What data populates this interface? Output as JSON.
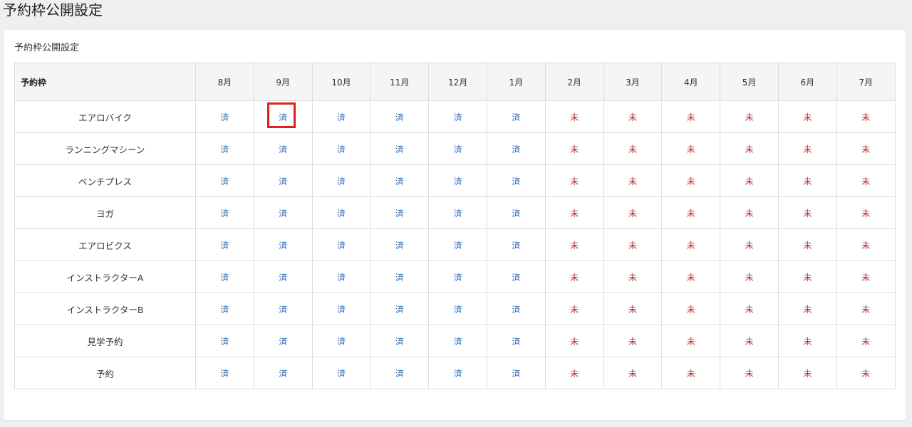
{
  "page": {
    "title": "予約枠公開設定"
  },
  "panel": {
    "title": "予約枠公開設定"
  },
  "table": {
    "corner_header": "予約枠",
    "months": [
      "8月",
      "9月",
      "10月",
      "11月",
      "12月",
      "1月",
      "2月",
      "3月",
      "4月",
      "5月",
      "6月",
      "7月"
    ],
    "rows": [
      {
        "label": "エアロバイク",
        "statuses": [
          "済",
          "済",
          "済",
          "済",
          "済",
          "済",
          "未",
          "未",
          "未",
          "未",
          "未",
          "未"
        ]
      },
      {
        "label": "ランニングマシーン",
        "statuses": [
          "済",
          "済",
          "済",
          "済",
          "済",
          "済",
          "未",
          "未",
          "未",
          "未",
          "未",
          "未"
        ]
      },
      {
        "label": "ベンチプレス",
        "statuses": [
          "済",
          "済",
          "済",
          "済",
          "済",
          "済",
          "未",
          "未",
          "未",
          "未",
          "未",
          "未"
        ]
      },
      {
        "label": "ヨガ",
        "statuses": [
          "済",
          "済",
          "済",
          "済",
          "済",
          "済",
          "未",
          "未",
          "未",
          "未",
          "未",
          "未"
        ]
      },
      {
        "label": "エアロビクス",
        "statuses": [
          "済",
          "済",
          "済",
          "済",
          "済",
          "済",
          "未",
          "未",
          "未",
          "未",
          "未",
          "未"
        ]
      },
      {
        "label": "インストラクターA",
        "statuses": [
          "済",
          "済",
          "済",
          "済",
          "済",
          "済",
          "未",
          "未",
          "未",
          "未",
          "未",
          "未"
        ]
      },
      {
        "label": "インストラクターB",
        "statuses": [
          "済",
          "済",
          "済",
          "済",
          "済",
          "済",
          "未",
          "未",
          "未",
          "未",
          "未",
          "未"
        ]
      },
      {
        "label": "見学予約",
        "statuses": [
          "済",
          "済",
          "済",
          "済",
          "済",
          "済",
          "未",
          "未",
          "未",
          "未",
          "未",
          "未"
        ]
      },
      {
        "label": "予約",
        "statuses": [
          "済",
          "済",
          "済",
          "済",
          "済",
          "済",
          "未",
          "未",
          "未",
          "未",
          "未",
          "未"
        ]
      }
    ],
    "highlighted_cell": {
      "row": 0,
      "column": 1
    }
  },
  "colors": {
    "done": "#2f6db5",
    "pending": "#b52a2a",
    "highlight": "#e02020"
  }
}
